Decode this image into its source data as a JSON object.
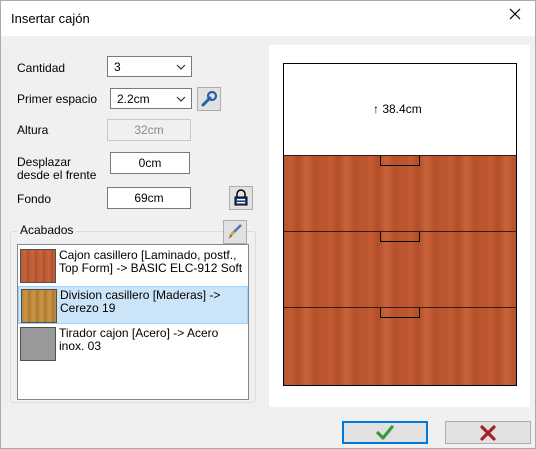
{
  "window": {
    "title": "Insertar cajón"
  },
  "form": {
    "cantidad_label": "Cantidad",
    "cantidad_value": "3",
    "primer_espacio_label": "Primer espacio",
    "primer_espacio_value": "2.2cm",
    "altura_label": "Altura",
    "altura_value": "32cm",
    "desplazar_label_1": "Desplazar",
    "desplazar_label_2": "desde el frente",
    "desplazar_value": "0cm",
    "fondo_label": "Fondo",
    "fondo_value": "69cm"
  },
  "acabados": {
    "label": "Acabados",
    "items": [
      {
        "text": "Cajon casillero [Laminado, postf., Top Form] -> BASIC ELC-912 Soft",
        "swatch": "#b85a34",
        "selected": false
      },
      {
        "text": "Division casillero [Maderas] -> Cerezo 19",
        "swatch": "#c08a3c",
        "selected": true
      },
      {
        "text": "Tirador cajon [Acero] -> Acero inox. 03",
        "swatch": "#999999",
        "selected": false
      }
    ]
  },
  "preview": {
    "space_label": "↑ 38.4cm",
    "drawer_count": 3,
    "colors": {
      "wood": "#c45c33",
      "handle": "#000000"
    }
  },
  "icons": {
    "close": "close-icon",
    "wrench": "wrench-icon",
    "lock": "lock-icon",
    "paint": "paint-brush-icon",
    "ok": "check-icon",
    "cancel": "x-icon"
  },
  "colors": {
    "ok_check": "#3a9a3a",
    "cancel_x": "#a3202a",
    "selection": "#cce4f7"
  }
}
